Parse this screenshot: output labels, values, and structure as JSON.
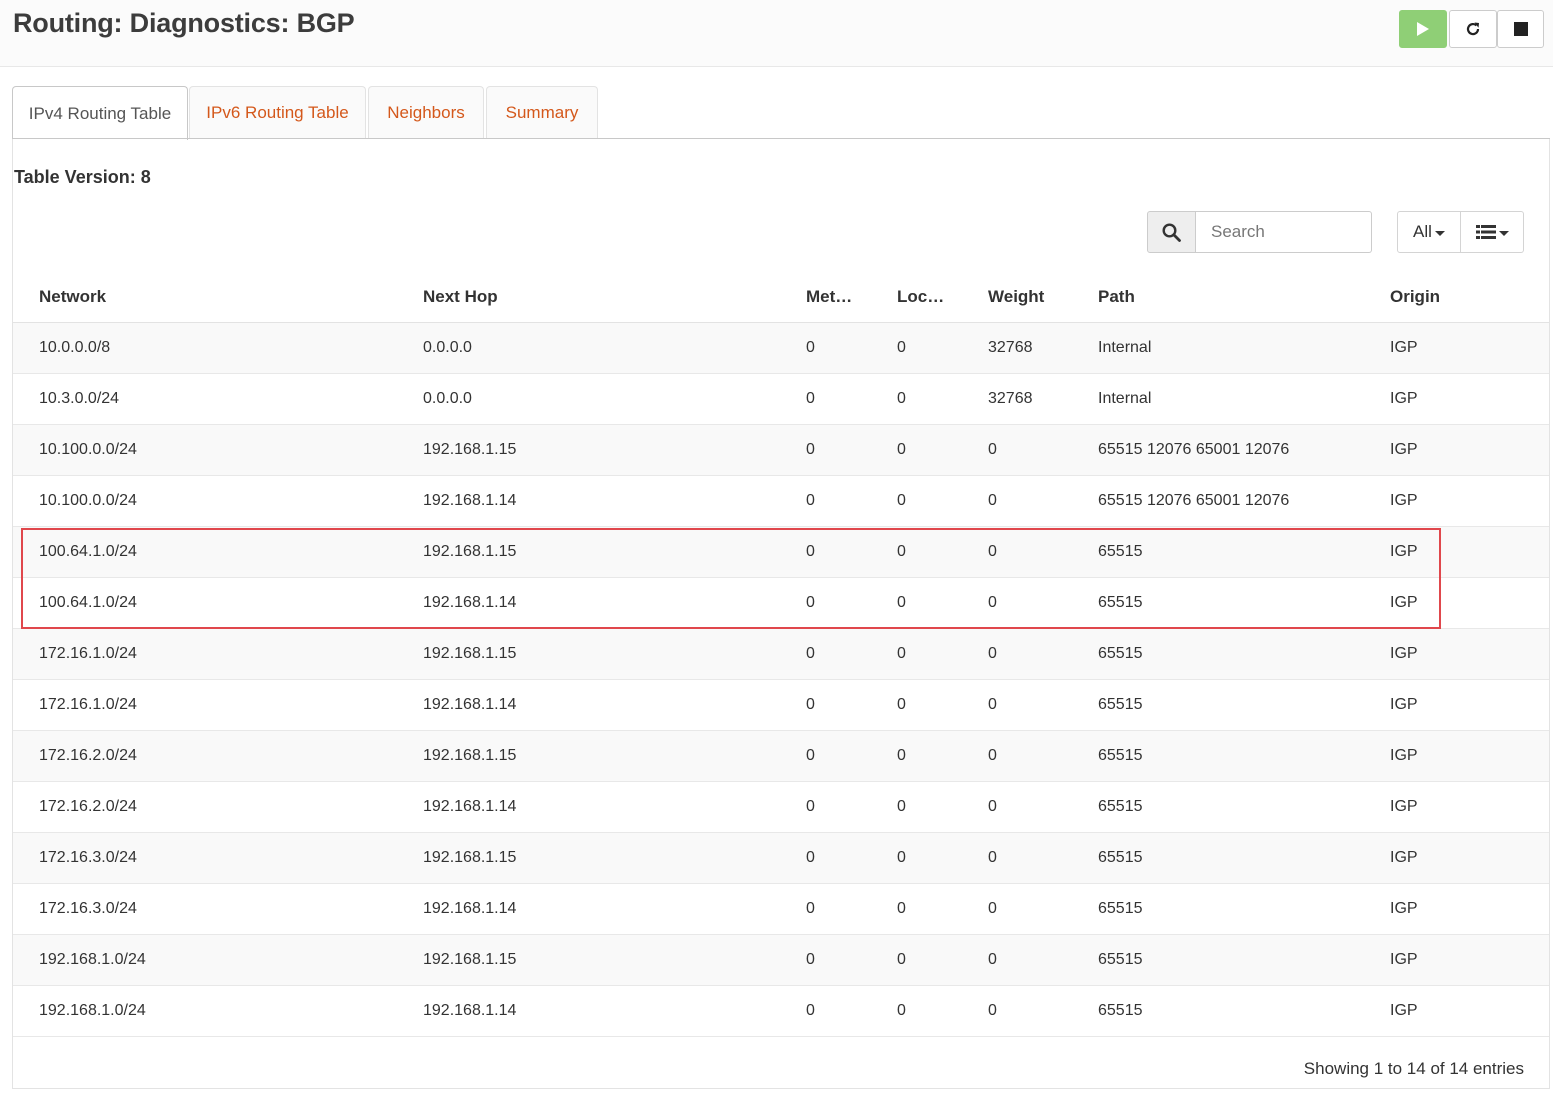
{
  "header": {
    "title": "Routing: Diagnostics: BGP",
    "buttons": [
      {
        "name": "play",
        "icon": "play-icon"
      },
      {
        "name": "refresh",
        "icon": "refresh-icon"
      },
      {
        "name": "stop",
        "icon": "stop-icon"
      }
    ]
  },
  "tabs": [
    {
      "label": "IPv4 Routing Table",
      "active": true
    },
    {
      "label": "IPv6 Routing Table",
      "active": false
    },
    {
      "label": "Neighbors",
      "active": false
    },
    {
      "label": "Summary",
      "active": false
    }
  ],
  "table_version": "Table Version: 8",
  "search": {
    "placeholder": "Search",
    "value": "",
    "icon": "search-icon"
  },
  "controls": {
    "rows_selector": "All",
    "columns_icon": "list-columns-icon"
  },
  "table": {
    "columns": [
      "Network",
      "Next Hop",
      "Met…",
      "Loc…",
      "Weight",
      "Path",
      "Origin"
    ],
    "rows": [
      [
        "10.0.0.0/8",
        "0.0.0.0",
        "0",
        "0",
        "32768",
        "Internal",
        "IGP"
      ],
      [
        "10.3.0.0/24",
        "0.0.0.0",
        "0",
        "0",
        "32768",
        "Internal",
        "IGP"
      ],
      [
        "10.100.0.0/24",
        "192.168.1.15",
        "0",
        "0",
        "0",
        "65515 12076 65001 12076",
        "IGP"
      ],
      [
        "10.100.0.0/24",
        "192.168.1.14",
        "0",
        "0",
        "0",
        "65515 12076 65001 12076",
        "IGP"
      ],
      [
        "100.64.1.0/24",
        "192.168.1.15",
        "0",
        "0",
        "0",
        "65515",
        "IGP"
      ],
      [
        "100.64.1.0/24",
        "192.168.1.14",
        "0",
        "0",
        "0",
        "65515",
        "IGP"
      ],
      [
        "172.16.1.0/24",
        "192.168.1.15",
        "0",
        "0",
        "0",
        "65515",
        "IGP"
      ],
      [
        "172.16.1.0/24",
        "192.168.1.14",
        "0",
        "0",
        "0",
        "65515",
        "IGP"
      ],
      [
        "172.16.2.0/24",
        "192.168.1.15",
        "0",
        "0",
        "0",
        "65515",
        "IGP"
      ],
      [
        "172.16.2.0/24",
        "192.168.1.14",
        "0",
        "0",
        "0",
        "65515",
        "IGP"
      ],
      [
        "172.16.3.0/24",
        "192.168.1.15",
        "0",
        "0",
        "0",
        "65515",
        "IGP"
      ],
      [
        "172.16.3.0/24",
        "192.168.1.14",
        "0",
        "0",
        "0",
        "65515",
        "IGP"
      ],
      [
        "192.168.1.0/24",
        "192.168.1.15",
        "0",
        "0",
        "0",
        "65515",
        "IGP"
      ],
      [
        "192.168.1.0/24",
        "192.168.1.14",
        "0",
        "0",
        "0",
        "65515",
        "IGP"
      ]
    ],
    "highlighted_rows": [
      4,
      5
    ]
  },
  "footer": {
    "info": "Showing 1 to 14 of 14 entries"
  },
  "colors": {
    "tab_link": "#d4581b",
    "play_button": "#8fcf76",
    "highlight_border": "#e0474c"
  }
}
